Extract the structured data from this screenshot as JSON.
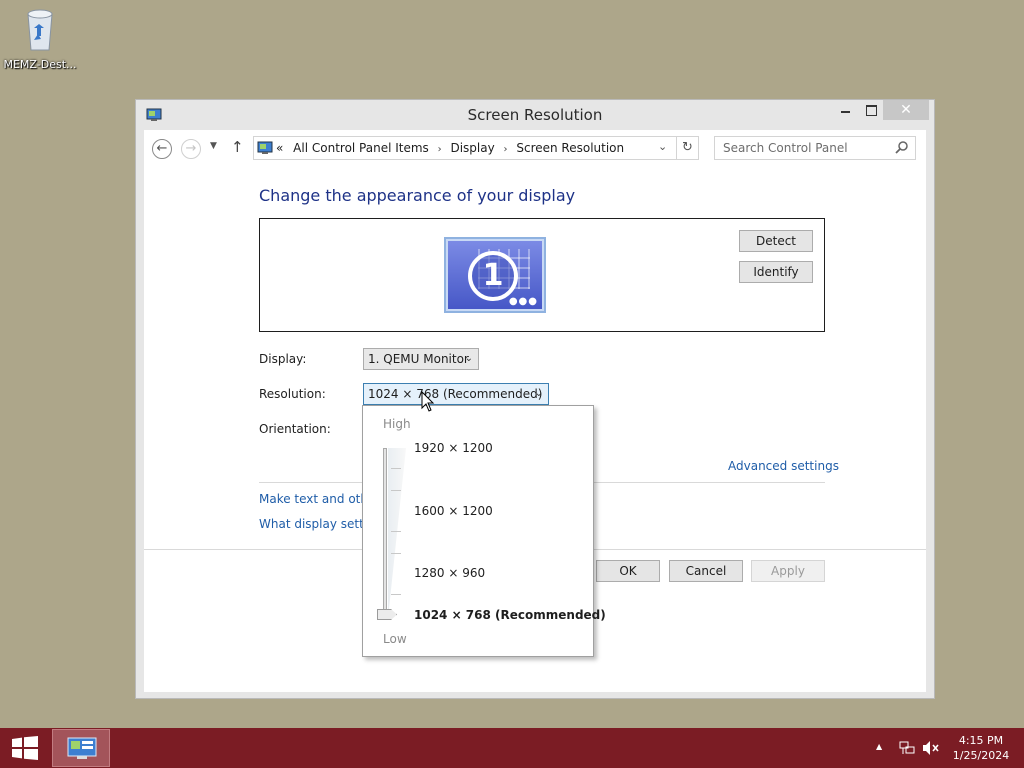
{
  "desktop": {
    "icons": [
      {
        "label": "MEMZ-Dest..."
      }
    ]
  },
  "window": {
    "title": "Screen Resolution",
    "close_glyph": "✕"
  },
  "nav": {
    "back_glyph": "←",
    "forward_glyph": "→",
    "recent_glyph": "▼",
    "up_glyph": "↑"
  },
  "address": {
    "overflow": "«",
    "crumbs": [
      "All Control Panel Items",
      "Display",
      "Screen Resolution"
    ],
    "separator": "›",
    "drop_glyph": "⌄",
    "refresh_glyph": "↻"
  },
  "search": {
    "placeholder": "Search Control Panel"
  },
  "main": {
    "heading": "Change the appearance of your display",
    "monitor_number": "1",
    "detect_label": "Detect",
    "identify_label": "Identify",
    "display_label": "Display:",
    "display_value": "1. QEMU Monitor",
    "resolution_label": "Resolution:",
    "resolution_value": "1024 × 768 (Recommended)",
    "orientation_label": "Orientation:",
    "advanced_link": "Advanced settings",
    "text_link": "Make text and other",
    "settings_link": "What display setting",
    "ok_label": "OK",
    "cancel_label": "Cancel",
    "apply_label": "Apply"
  },
  "resolution_popup": {
    "high_label": "High",
    "low_label": "Low",
    "options": [
      "1920 × 1200",
      "1600 × 1200",
      "1280 × 960",
      "1024 × 768 (Recommended)"
    ],
    "selected_index": 3
  },
  "taskbar": {
    "tray_up_glyph": "▲",
    "time": "4:15 PM",
    "date": "1/25/2024"
  },
  "colors": {
    "desktop": "#ada68a",
    "taskbar": "#7b1c24",
    "heading": "#1e3287",
    "link": "#1f5da8"
  }
}
